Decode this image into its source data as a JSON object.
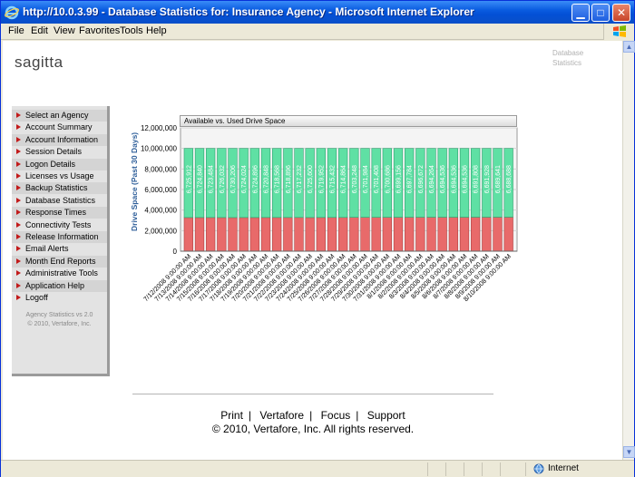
{
  "window": {
    "title": "http://10.0.3.99 - Database Statistics for: Insurance Agency - Microsoft Internet Explorer"
  },
  "menu": [
    "File",
    "Edit",
    "View",
    "Favorites",
    "Tools",
    "Help"
  ],
  "page": {
    "logo": "sagitta",
    "header_right": "Database Statistics"
  },
  "sidebar": {
    "items": [
      {
        "label": "Select an Agency"
      },
      {
        "label": "Account Summary"
      },
      {
        "label": "Account Information"
      },
      {
        "label": "Session Details"
      },
      {
        "label": "Logon Details"
      },
      {
        "label": "Licenses vs Usage"
      },
      {
        "label": "Backup Statistics"
      },
      {
        "label": "Database Statistics"
      },
      {
        "label": "Response Times"
      },
      {
        "label": "Connectivity Tests"
      },
      {
        "label": "Release Information"
      },
      {
        "label": "Email Alerts"
      },
      {
        "label": "Month End Reports"
      },
      {
        "label": "Administrative Tools"
      },
      {
        "label": "Application Help"
      },
      {
        "label": "Logoff"
      }
    ],
    "version": "Agency Statistics vs 2.0",
    "copyright": "© 2010, Vertafore, Inc."
  },
  "chart_data": {
    "type": "bar",
    "stacked": true,
    "title": "Available vs. Used Drive Space",
    "ylabel": "Drive Space (Past 30 Days)",
    "xlabel": "",
    "ylim": [
      0,
      12000000
    ],
    "yticks": [
      "0",
      "2,000,000",
      "4,000,000",
      "6,000,000",
      "8,000,000",
      "10,000,000",
      "12,000,000"
    ],
    "grid": true,
    "categories": [
      "7/12/2008 9:00:00 AM",
      "7/13/2008 9:00:00 AM",
      "7/14/2008 9:00:00 AM",
      "7/15/2008 9:00:00 AM",
      "7/16/2008 9:00:00 AM",
      "7/17/2008 9:00:00 AM",
      "7/18/2008 9:00:00 AM",
      "7/19/2008 9:00:00 AM",
      "7/20/2008 9:00:00 AM",
      "7/21/2008 9:00:00 AM",
      "7/22/2008 9:00:00 AM",
      "7/23/2008 9:00:00 AM",
      "7/24/2008 9:00:00 AM",
      "7/25/2008 9:00:00 AM",
      "7/26/2008 9:00:00 AM",
      "7/27/2008 9:00:00 AM",
      "7/28/2008 9:00:00 AM",
      "7/29/2008 9:00:00 AM",
      "7/30/2008 9:00:00 AM",
      "7/31/2008 9:00:00 AM",
      "8/1/2008 9:00:00 AM",
      "8/2/2008 9:00:00 AM",
      "8/3/2008 9:00:00 AM",
      "8/4/2008 9:00:00 AM",
      "8/5/2008 9:00:00 AM",
      "8/6/2008 9:00:00 AM",
      "8/7/2008 9:00:00 AM",
      "8/8/2008 9:00:00 AM",
      "8/9/2008 9:00:00 AM",
      "8/10/2008 9:00:00 AM"
    ],
    "series": [
      {
        "values": [
          3274088,
          3275160,
          3276516,
          3273968,
          3269794,
          3275976,
          3275104,
          3279152,
          3281432,
          3281104,
          3282768,
          3274400,
          3280048,
          3284568,
          3285136,
          3296752,
          3298016,
          3298592,
          3299314,
          3300844,
          3302216,
          3303328,
          3305736,
          3305464,
          3305464,
          3305464,
          3308192,
          3308072,
          3310359,
          3311312
        ],
        "color": "#e86a6a"
      },
      {
        "values": [
          6725912,
          6724840,
          6723484,
          6726032,
          6730206,
          6724024,
          6724896,
          6720848,
          6718568,
          6718896,
          6717232,
          6725600,
          6719952,
          6715432,
          6714864,
          6703248,
          6701984,
          6701408,
          6700686,
          6699156,
          6697784,
          6696672,
          6694264,
          6694536,
          6694536,
          6694536,
          6691808,
          6691928,
          6689641,
          6688688
        ],
        "labels": [
          "6,725,912",
          "6,724,840",
          "6,723,484",
          "6,726,032",
          "6,730,206",
          "6,724,024",
          "6,724,896",
          "6,720,848",
          "6,718,568",
          "6,718,896",
          "6,717,232",
          "6,725,600",
          "6,719,952",
          "6,715,432",
          "6,714,864",
          "6,703,248",
          "6,701,984",
          "6,701,408",
          "6,700,686",
          "6,699,156",
          "6,697,784",
          "6,696,672",
          "6,694,264",
          "6,694,536",
          "6,694,536",
          "6,694,536",
          "6,691,808",
          "6,691,928",
          "6,689,641",
          "6,688,688"
        ],
        "color": "#5fe0a4"
      }
    ]
  },
  "footer": {
    "links": [
      "Print",
      "Vertafore",
      "Focus",
      "Support"
    ],
    "separator": "|",
    "copyright": "© 2010, Vertafore, Inc. All rights reserved."
  },
  "status": {
    "zone": "Internet"
  }
}
